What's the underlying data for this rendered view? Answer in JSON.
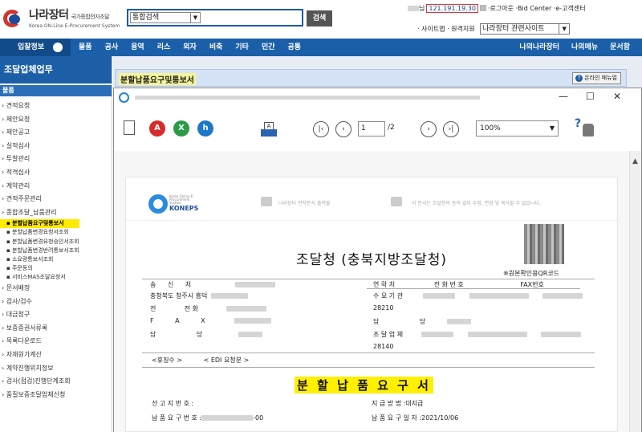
{
  "header": {
    "logo_title": "나라장터",
    "logo_subtitle": "국가종합전자조달",
    "logo_english": "Korea ON-Line E-Procurement System",
    "search_select": "통합검색",
    "search_button": "검색",
    "ip": "121.191.19.30",
    "user_suffix": "님",
    "links": [
      "·로그아웃",
      "·Bid Center",
      "·e-고객센터"
    ],
    "sitemap": "· 사이트맵",
    "remote": "· 원격지원",
    "related_sites": "나라장터 관련사이트"
  },
  "nav": {
    "first": "입찰정보",
    "items": [
      "물품",
      "공사",
      "용역",
      "리스",
      "외자",
      "비축",
      "기타",
      "민간",
      "공통"
    ],
    "right": [
      "나의나라장터",
      "나의메뉴",
      "문서함"
    ]
  },
  "sidebar": {
    "title": "조달업체업무",
    "category": "물품",
    "items_top": [
      "견적요청",
      "제안요청",
      "제안공고",
      "실적심사",
      "투찰관리",
      "적격심사",
      "계약관리",
      "견적주문관리",
      "종합조달_납품관리"
    ],
    "sub_items": [
      "분할납품요구및통보서",
      "분할납품변경요청서조회",
      "분할납품변경요청승인서조회",
      "분할납품변경반려통보서조회",
      "소요량통보서조회",
      "주문동의",
      "서비스MAS조달요청서"
    ],
    "items_bottom": [
      "문서배정",
      "검사/검수",
      "대금청구",
      "보증증권서류록",
      "목록다운로드",
      "자재원가계산",
      "계약진행위치정보",
      "검사(점검)진행단계조회",
      "품질보증조달업체신청"
    ]
  },
  "main": {
    "page_title": "분할납품요구및통보서",
    "manual_button": "온라인 매뉴얼"
  },
  "viewer": {
    "page_current": "1",
    "page_total": "/2",
    "zoom": "100%",
    "window_controls": [
      "—",
      "☐",
      "✕"
    ]
  },
  "document": {
    "logo": "KONEPS",
    "logo_small": "Korea Online E-Procurement System",
    "strip_note_1": "나라장터 전자문서 출력물",
    "strip_note_2": "이 문서는 조달청의 동의 없이 수정, 변경 및 복사할 수 없습니다.",
    "issuer": "조달청 (충북지방조달청)",
    "qr_note": "※원본확인용QR코드",
    "sender_label": "송 신 처",
    "sender_addr": "충청북도 청주시 흥덕",
    "phone_label": "전 화",
    "fax_label": "F A X",
    "person_label": "담 당",
    "contact_headers": [
      "연 락 처",
      "전 화 번 호",
      "FAX번호"
    ],
    "receiver_label": "수 요 기 관",
    "receiver_code": "28210",
    "receiver_person": "담 당",
    "supplier_label": "조 달 업 체",
    "supplier_code": "28140",
    "receive_label": "<휴징수 >",
    "edi_label": "< EDI 요청분 >",
    "doc_name": "분 할 납 품 요 구 서",
    "notice_no_label": "선 고 지 번 호 :",
    "pay_method_label": "지 급 방 법 :대지급",
    "request_no_label": "납 품 요 구 번 호 :",
    "request_no_value": "-00",
    "request_date_label": "납 품 요 구 일 자 :2021/10/06"
  }
}
